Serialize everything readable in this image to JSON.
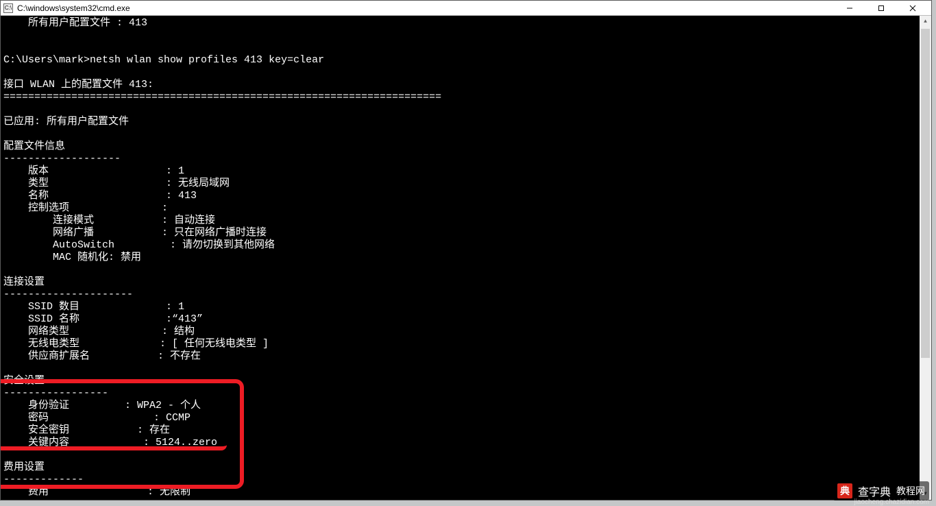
{
  "window": {
    "title": "C:\\windows\\system32\\cmd.exe",
    "icon_label": "C:\\"
  },
  "terminal": {
    "lines": [
      "    所有用户配置文件 : 413",
      "",
      "",
      "C:\\Users\\mark>netsh wlan show profiles 413 key=clear",
      "",
      "接口 WLAN 上的配置文件 413:",
      "=======================================================================",
      "",
      "已应用: 所有用户配置文件",
      "",
      "配置文件信息",
      "-------------------",
      "    版本                   : 1",
      "    类型                   : 无线局域网",
      "    名称                   : 413",
      "    控制选项               :",
      "        连接模式           : 自动连接",
      "        网络广播           : 只在网络广播时连接",
      "        AutoSwitch         : 请勿切换到其他网络",
      "        MAC 随机化: 禁用",
      "",
      "连接设置",
      "---------------------",
      "    SSID 数目              : 1",
      "    SSID 名称              :“413”",
      "    网络类型               : 结构",
      "    无线电类型             : [ 任何无线电类型 ]",
      "    供应商扩展名           : 不存在",
      "",
      "安全设置",
      "-----------------",
      "    身份验证         : WPA2 - 个人",
      "    密码                 : CCMP",
      "    安全密钥           : 存在",
      "    关键内容            : 5124..zero",
      "",
      "费用设置",
      "-------------",
      "    费用                : 无限制"
    ]
  },
  "watermark": {
    "brand": "查字典",
    "tag": "教程网",
    "url": "jiaocheng.chazidian.com"
  }
}
